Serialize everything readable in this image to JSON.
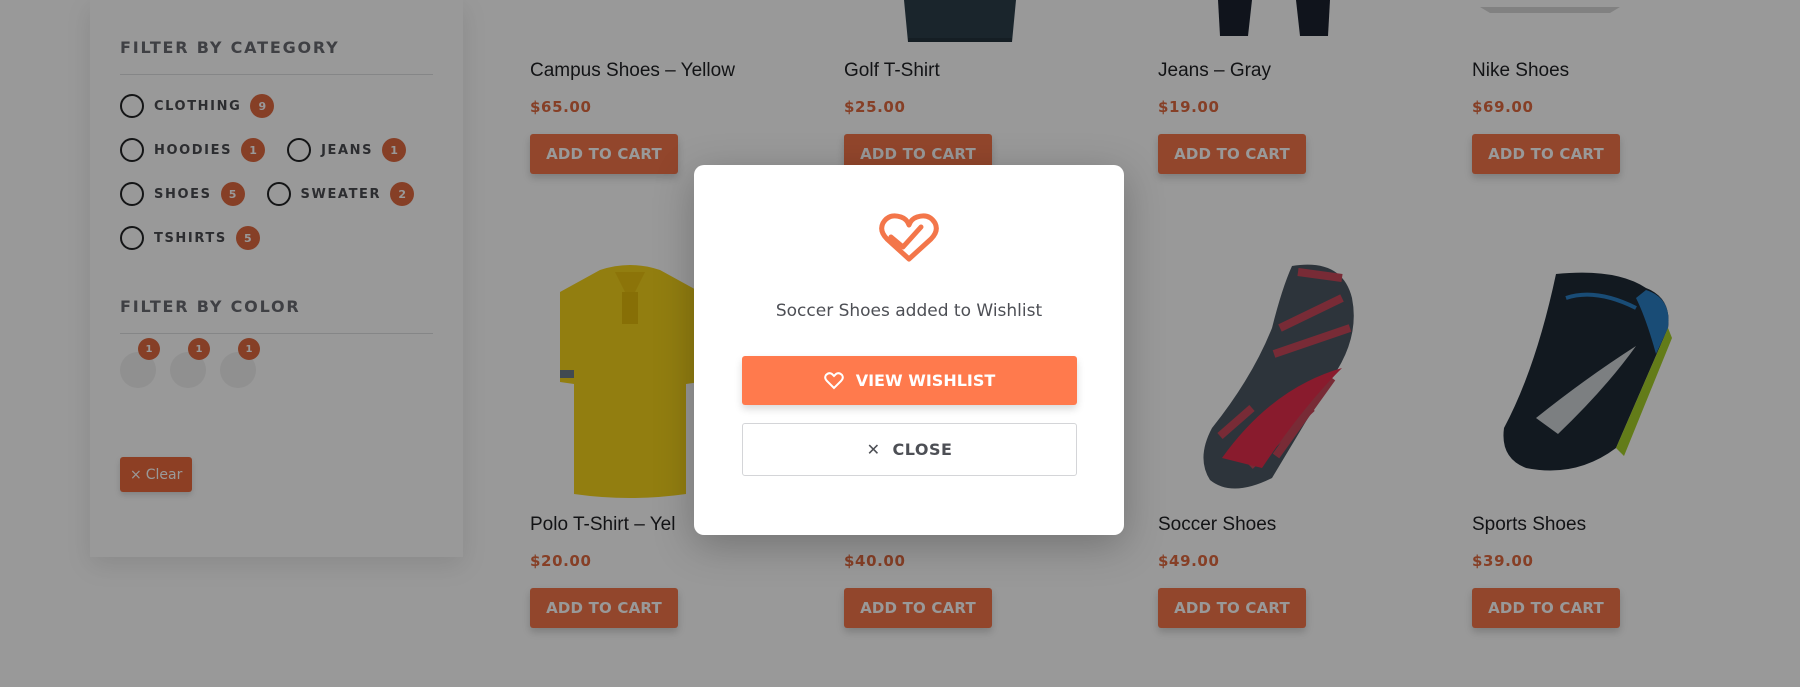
{
  "sidebar": {
    "category_title": "FILTER BY CATEGORY",
    "categories": [
      {
        "label": "CLOTHING",
        "count": "9"
      },
      {
        "label": "HOODIES",
        "count": "1"
      },
      {
        "label": "JEANS",
        "count": "1"
      },
      {
        "label": "SHOES",
        "count": "5"
      },
      {
        "label": "SWEATER",
        "count": "2"
      },
      {
        "label": "TSHIRTS",
        "count": "5"
      }
    ],
    "color_title": "FILTER BY COLOR",
    "colors": [
      {
        "count": "1"
      },
      {
        "count": "1"
      },
      {
        "count": "1"
      }
    ],
    "clear_label": "Clear"
  },
  "products": [
    {
      "name": "Campus Shoes – Yellow",
      "price": "$65.00",
      "cart": "ADD TO CART"
    },
    {
      "name": "Golf T-Shirt",
      "price": "$25.00",
      "cart": "ADD TO CART"
    },
    {
      "name": "Jeans – Gray",
      "price": "$19.00",
      "cart": "ADD TO CART"
    },
    {
      "name": "Nike Shoes",
      "price": "$69.00",
      "cart": "ADD TO CART"
    },
    {
      "name": "Polo T-Shirt – Yel",
      "price": "$20.00",
      "cart": "ADD TO CART"
    },
    {
      "name": "",
      "price": "$40.00",
      "cart": "ADD TO CART"
    },
    {
      "name": "Soccer Shoes",
      "price": "$49.00",
      "cart": "ADD TO CART"
    },
    {
      "name": "Sports Shoes",
      "price": "$39.00",
      "cart": "ADD TO CART"
    }
  ],
  "modal": {
    "message": "Soccer Shoes added to Wishlist",
    "view_label": "VIEW WISHLIST",
    "close_label": "CLOSE",
    "icon": "heart-check-icon"
  },
  "colors": {
    "accent": "#f3764a",
    "badge": "#e06a40",
    "overlay": "rgba(0,0,0,0.40)"
  }
}
